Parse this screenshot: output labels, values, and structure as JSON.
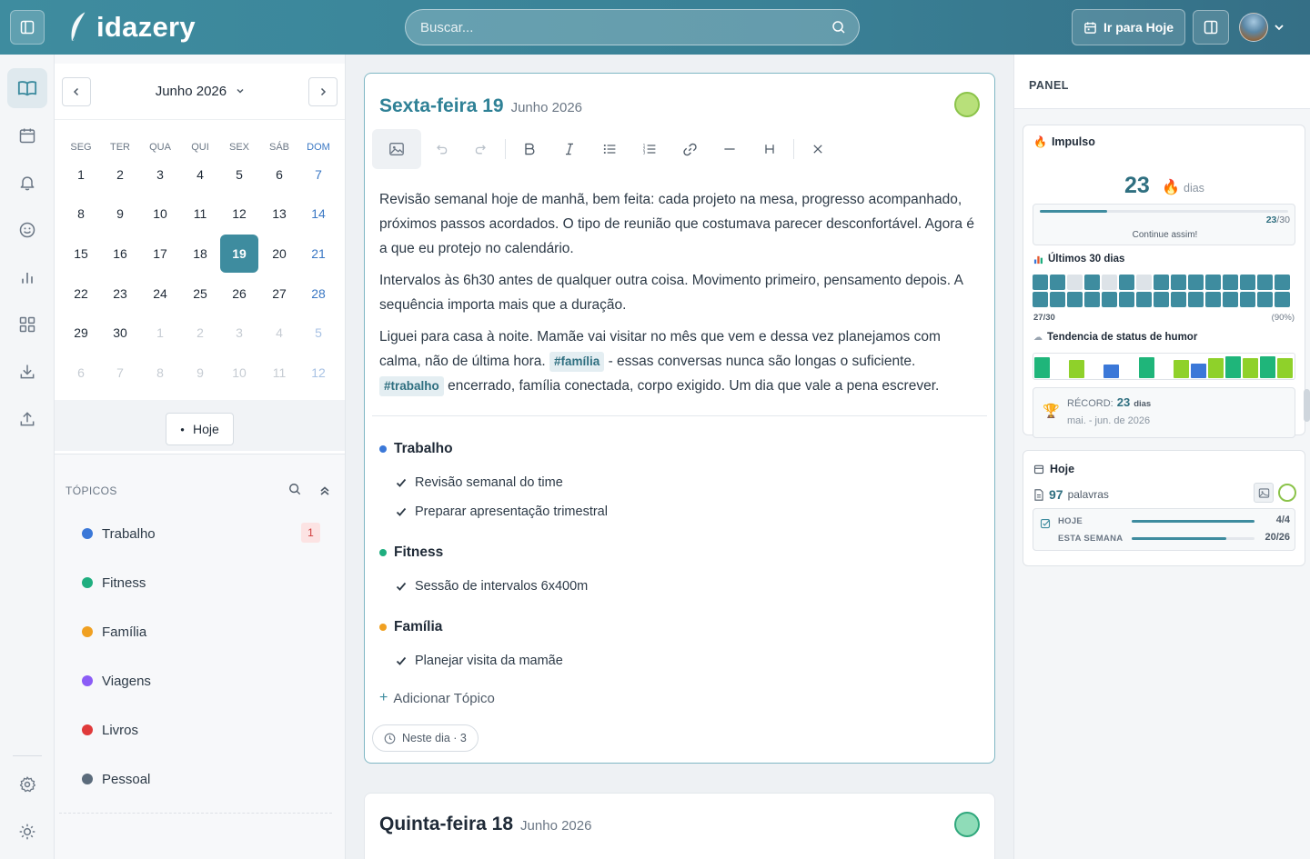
{
  "app": {
    "name": "idazery"
  },
  "header": {
    "search_placeholder": "Buscar...",
    "today_button": "Ir para Hoje"
  },
  "calendar": {
    "month_label": "Junho 2026",
    "weekdays": [
      "SEG",
      "TER",
      "QUA",
      "QUI",
      "SEX",
      "SÁB",
      "DOM"
    ],
    "weeks": [
      [
        "1",
        "2",
        "3",
        "4",
        "5",
        "6",
        "7"
      ],
      [
        "8",
        "9",
        "10",
        "11",
        "12",
        "13",
        "14"
      ],
      [
        "15",
        "16",
        "17",
        "18",
        "19",
        "20",
        "21"
      ],
      [
        "22",
        "23",
        "24",
        "25",
        "26",
        "27",
        "28"
      ],
      [
        "29",
        "30",
        "1",
        "2",
        "3",
        "4",
        "5"
      ],
      [
        "6",
        "7",
        "8",
        "9",
        "10",
        "11",
        "12"
      ]
    ],
    "selected_day": "19",
    "today_button": "Hoje"
  },
  "topics": {
    "heading": "TÓPICOS",
    "items": [
      {
        "label": "Trabalho",
        "color": "#3b78d8",
        "count": "1"
      },
      {
        "label": "Fitness",
        "color": "#1fae7f",
        "count": ""
      },
      {
        "label": "Família",
        "color": "#f0a021",
        "count": ""
      },
      {
        "label": "Viagens",
        "color": "#8b5cf6",
        "count": ""
      },
      {
        "label": "Livros",
        "color": "#e03a3a",
        "count": ""
      },
      {
        "label": "Pessoal",
        "color": "#5b6b7b",
        "count": ""
      }
    ]
  },
  "entry": {
    "weekday": "Sexta-feira 19",
    "month_year": "Junho 2026",
    "mood_color": "#b8e07a",
    "paragraph1": "Revisão semanal hoje de manhã, bem feita: cada projeto na mesa, progresso acompanhado, próximos passos acordados. O tipo de reunião que costumava parecer desconfortável. Agora é a que eu protejo no calendário.",
    "paragraph2": "Intervalos às 6h30 antes de qualquer outra coisa. Movimento primeiro, pensamento depois. A sequência importa mais que a duração.",
    "paragraph3_a": "Liguei para casa à noite. Mamãe vai visitar no mês que vem e dessa vez planejamos com calma, não de última hora.",
    "tag1": "#família",
    "paragraph3_b": "- essas conversas nunca são longas o suficiente.",
    "tag2": "#trabalho",
    "paragraph3_c": "encerrado, família conectada, corpo exigido. Um dia que vale a pena escrever.",
    "sections": [
      {
        "title": "Trabalho",
        "color": "#3b78d8",
        "tasks": [
          "Revisão semanal do time",
          "Preparar apresentação trimestral"
        ]
      },
      {
        "title": "Fitness",
        "color": "#1fae7f",
        "tasks": [
          "Sessão de intervalos 6x400m"
        ]
      },
      {
        "title": "Família",
        "color": "#f0a021",
        "tasks": [
          "Planejar visita da mamãe"
        ]
      }
    ],
    "add_topic": "Adicionar Tópico",
    "on_this_day": "Neste dia · 3"
  },
  "entry2": {
    "weekday": "Quinta-feira 18",
    "month_year": "Junho 2026",
    "mood_color": "#8fdcb8"
  },
  "panel": {
    "title": "PANEL",
    "streak": {
      "label": "Impulso",
      "value": "23",
      "unit": "dias",
      "progress_current": "23",
      "progress_total": "/30",
      "progress_fraction": 0.27,
      "message": "Continue assim!"
    },
    "last30": {
      "label": "Últimos 30 dias",
      "cells": [
        1,
        1,
        0,
        1,
        0,
        1,
        0,
        1,
        1,
        1,
        1,
        1,
        1,
        1,
        1,
        1,
        1,
        1,
        1,
        1,
        1,
        1,
        1,
        1,
        1,
        1,
        1,
        1,
        1,
        1
      ],
      "count": "27/30",
      "percent": "(90%)"
    },
    "mood_trend": {
      "label": "Tendencia de status de humor",
      "levels": [
        0.85,
        0,
        0.75,
        0,
        0.55,
        0,
        0.85,
        0,
        0.75,
        0.6,
        0.8,
        0.9,
        0.8,
        0.9,
        0.8
      ],
      "colors": [
        "#1fb57a",
        "#ffffff",
        "#8fd12a",
        "#ffffff",
        "#3b78d8",
        "#ffffff",
        "#1fb57a",
        "#ffffff",
        "#8fd12a",
        "#3b78d8",
        "#8fd12a",
        "#1fb57a",
        "#8fd12a",
        "#1fb57a",
        "#8fd12a"
      ]
    },
    "record": {
      "label": "RÉCORD:",
      "value": "23",
      "unit": "dias",
      "range": "mai. - jun. de 2026"
    },
    "today": {
      "label": "Hoje",
      "words_value": "97",
      "words_unit": "palavras",
      "today_label": "HOJE",
      "today_value": "4/4",
      "today_fraction": 1.0,
      "week_label": "ESTA SEMANA",
      "week_value": "20/26",
      "week_fraction": 0.77
    }
  }
}
